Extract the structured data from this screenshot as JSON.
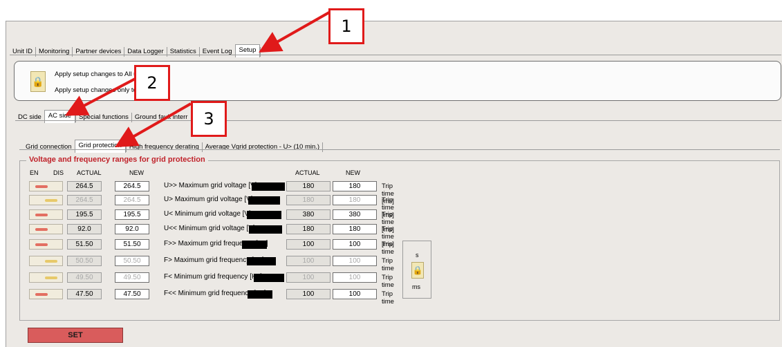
{
  "main_tabs": [
    "Unit ID",
    "Monitoring",
    "Partner devices",
    "Data Logger",
    "Statistics",
    "Event Log",
    "Setup"
  ],
  "apply": {
    "all_units": "Apply setup changes to All units",
    "this_unit": "Apply setup changes only to this unit"
  },
  "sub_tabs": [
    "DC side",
    "AC side",
    "Special functions",
    "Ground fault interr"
  ],
  "grid_tabs": [
    "Grid connection",
    "Grid protection",
    "High frequency derating",
    "Average Vgrid protection - U> (10 min.)"
  ],
  "group_title": "Voltage and frequency ranges for grid protection",
  "headers": {
    "en": "EN",
    "dis": "DIS",
    "actual": "ACTUAL",
    "new": "NEW",
    "actual2": "ACTUAL",
    "new2": "NEW"
  },
  "rows": [
    {
      "enabled": true,
      "actual": "264.5",
      "new": "264.5",
      "label": "U>> Maximum grid voltage [V]",
      "actual2": "180",
      "new2": "180",
      "trip": "Trip time [ms]"
    },
    {
      "enabled": false,
      "actual": "264.5",
      "new": "264.5",
      "label": "U> Maximum grid voltage [V]",
      "actual2": "180",
      "new2": "180",
      "trip": "Trip time [ms]"
    },
    {
      "enabled": true,
      "actual": "195.5",
      "new": "195.5",
      "label": "U< Minimum grid voltage [V]",
      "actual2": "380",
      "new2": "380",
      "trip": "Trip time [ms]"
    },
    {
      "enabled": true,
      "actual": "92.0",
      "new": "92.0",
      "label": "U<< Minimum grid voltage [V]",
      "actual2": "180",
      "new2": "180",
      "trip": "Trip time [ms]"
    },
    {
      "enabled": true,
      "actual": "51.50",
      "new": "51.50",
      "label": "F>> Maximum grid frequency [Hz]",
      "actual2": "100",
      "new2": "100",
      "trip": "Trip time"
    },
    {
      "enabled": false,
      "actual": "50.50",
      "new": "50.50",
      "label": "F> Maximum grid frequency [Hz]",
      "actual2": "100",
      "new2": "100",
      "trip": "Trip time"
    },
    {
      "enabled": false,
      "actual": "49.50",
      "new": "49.50",
      "label": "F< Minimum grid frequency [Hz]",
      "actual2": "100",
      "new2": "100",
      "trip": "Trip time"
    },
    {
      "enabled": true,
      "actual": "47.50",
      "new": "47.50",
      "label": "F<< Minimum grid frequency [Hz]",
      "actual2": "100",
      "new2": "100",
      "trip": "Trip time"
    }
  ],
  "unit_toggle": {
    "s": "s",
    "ms": "ms"
  },
  "set_button": "SET",
  "callouts": [
    "1",
    "2",
    "3"
  ],
  "colors": {
    "accent_red": "#e01a1a",
    "group_title": "#c0222a",
    "set_button": "#d95c5c"
  }
}
